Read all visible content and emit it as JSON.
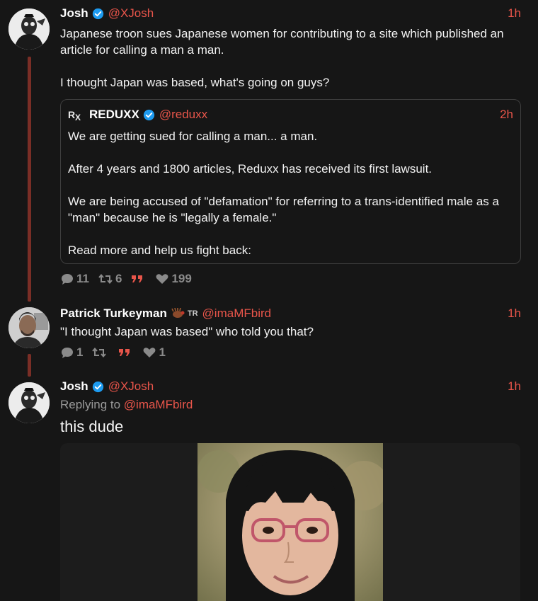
{
  "colors": {
    "background": "#161616",
    "accent": "#e8554a",
    "thread_line": "#7a2e26",
    "muted": "#8a8a8a",
    "verified": "#1d9bf0"
  },
  "tweets": [
    {
      "name": "Josh",
      "verified": true,
      "handle": "@XJosh",
      "time": "1h",
      "text": "Japanese troon sues Japanese women for contributing to a site which published an article for calling a man a man.\n\nI thought Japan was based, what's going on guys?",
      "quote": {
        "logo": "RX",
        "name": "REDUXX",
        "verified": true,
        "handle": "@reduxx",
        "time": "2h",
        "text": "We are getting sued for calling a man... a man.\n\nAfter 4 years and 1800 articles, Reduxx has received its first lawsuit.\n\nWe are being accused of \"defamation\" for referring to a trans-identified male as a \"man\" because he is \"legally a female.\"\n\nRead more and help us fight back:"
      },
      "stats": {
        "replies": "11",
        "retweets": "6",
        "likes": "199"
      }
    },
    {
      "name": "Patrick Turkeyman",
      "badge": "TR",
      "handle": "@imaMFbird",
      "time": "1h",
      "text": "\"I thought Japan was based\" who told you that?",
      "stats": {
        "replies": "1",
        "retweets": "",
        "likes": "1"
      }
    },
    {
      "name": "Josh",
      "verified": true,
      "handle": "@XJosh",
      "time": "1h",
      "reply_prefix": "Replying to ",
      "reply_mention": "@imaMFbird",
      "text": "this dude"
    }
  ],
  "icons": {
    "reply": "comment-icon",
    "retweet": "retweet-icon",
    "quote": "quote-icon",
    "like": "heart-icon",
    "verified": "verified-badge-icon"
  }
}
